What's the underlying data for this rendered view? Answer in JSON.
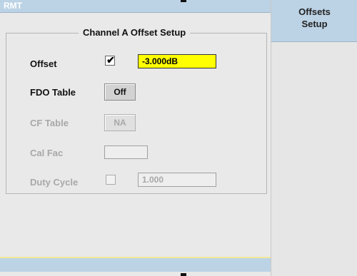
{
  "title_bar": {
    "mode": "RMT"
  },
  "softkey": {
    "line1": "Offsets",
    "line2": "Setup"
  },
  "group": {
    "title": "Channel A Offset Setup"
  },
  "rows": {
    "offset": {
      "label": "Offset",
      "checked": true,
      "value": "-3.000dB"
    },
    "fdo_table": {
      "label": "FDO Table",
      "button": "Off"
    },
    "cf_table": {
      "label": "CF Table",
      "button": "NA"
    },
    "cal_fac": {
      "label": "Cal Fac",
      "value": ""
    },
    "duty_cycle": {
      "label": "Duty Cycle",
      "checked": false,
      "value": "1.000"
    }
  },
  "status": {
    "text": ""
  },
  "colors": {
    "title_bar": "#bcd3e6",
    "highlight_value": "#ffff00",
    "panel_bg": "#e9e9e9",
    "disabled_text": "#a8a8a8"
  }
}
